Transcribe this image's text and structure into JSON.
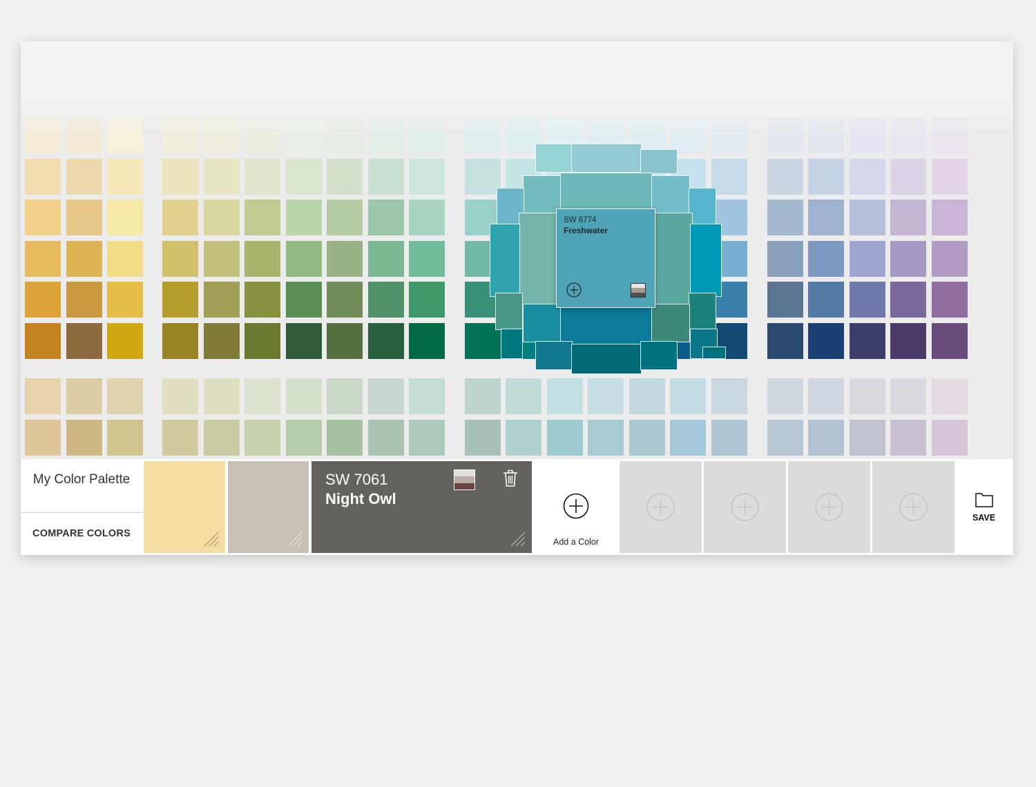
{
  "wall": {
    "columns": [
      [
        "#f5ecd8",
        "#f0dcae",
        "#f3d089",
        "#e8bb5e",
        "#dca33b",
        "#c38220",
        "#e6d3ac",
        "#ddc79b"
      ],
      [
        "#f3ead8",
        "#ecd9ad",
        "#e8c888",
        "#ddb353",
        "#c99a3f",
        "#8e6b3f",
        "#ddcda7",
        "#cdb785"
      ],
      [
        "#f7f0da",
        "#f7e8b8",
        "#f7e9a8",
        "#f2dc85",
        "#e3bd45",
        "#d0a812",
        "#dfd4ad",
        "#d1c48f"
      ],
      [
        "#f2eedd",
        "#ece4bc",
        "#e0d18f",
        "#d0c06a",
        "#b59d2e",
        "#988423",
        "#e2dec0",
        "#cfcb9f"
      ],
      [
        "#efeedf",
        "#e7e6c2",
        "#d8d7a0",
        "#c3c07d",
        "#a09f55",
        "#817b38",
        "#dedfc0",
        "#c9cca2"
      ],
      [
        "#eaeee0",
        "#dfe6cb",
        "#bfcb91",
        "#a7b56d",
        "#879140",
        "#6a7930",
        "#dae2cd",
        "#c6d1ad"
      ],
      [
        "#e9f0e6",
        "#d8e6cf",
        "#b8d6aa",
        "#93bb83",
        "#5b8e55",
        "#315c3b",
        "#d5e2ce",
        "#b4cca9"
      ],
      [
        "#e6ede4",
        "#d2e0cc",
        "#b4cba3",
        "#99b283",
        "#708c58",
        "#56713f",
        "#cbdac8",
        "#a6c1a2"
      ],
      [
        "#e3eee7",
        "#c9e1d2",
        "#9cc7aa",
        "#7db994",
        "#50916a",
        "#265e3e",
        "#c7d7cf",
        "#aac4b4"
      ],
      [
        "#e2eee9",
        "#cde6dc",
        "#a7d5c1",
        "#71bc98",
        "#3f9769",
        "#006b45",
        "#c4dcd1",
        "#acc9bb"
      ],
      [
        "#e1efef",
        "#c6e3df",
        "#98d1c8",
        "#73b9a8",
        "#399179",
        "#007356",
        "#bed4cc",
        "#a8c1b7"
      ],
      [
        "#e0efef",
        "#c5e4e4",
        "#8ed3d3",
        "#5fbdbd",
        "#2aa0a0",
        "#008181",
        "#c1dbd9",
        "#b2d0cf"
      ],
      [
        "#e2f0f3",
        "#c6e6ec",
        "#91d1db",
        "#5bb9c9",
        "#1a9fb4",
        "#007f94",
        "#c2dfe2",
        "#9fcbd0"
      ],
      [
        "#e1eff4",
        "#c7e5ef",
        "#93d3e7",
        "#57bcda",
        "#159fc4",
        "#007fa4",
        "#c5dde3",
        "#a8cbd3"
      ],
      [
        "#e1eef3",
        "#c9e4ee",
        "#a0d3e7",
        "#67bade",
        "#1a8ec2",
        "#05639a",
        "#c2d9e0",
        "#aac8d2"
      ],
      [
        "#e2eef3",
        "#c7e2ef",
        "#98cbe4",
        "#4fadd6",
        "#1a82b8",
        "#0a5a8a",
        "#c4dce4",
        "#a5c8d8"
      ],
      [
        "#e2ebf1",
        "#c7dceb",
        "#9fc4df",
        "#78aed0",
        "#3a80ab",
        "#124c74",
        "#c9d8e0",
        "#aec5d3"
      ],
      [
        "#e2e8ef",
        "#c9d5e1",
        "#a5b9cf",
        "#889fbb",
        "#5b7794",
        "#2a4a6f",
        "#cfd7de",
        "#b8c6d3"
      ],
      [
        "#e2e7ef",
        "#c6d2e5",
        "#9fb3d1",
        "#7d98c1",
        "#557aa6",
        "#1c3f72",
        "#d0d6df",
        "#b3c2d3"
      ],
      [
        "#e5e6f1",
        "#d5d8ec",
        "#b8bfdc",
        "#9ea6cf",
        "#7178aa",
        "#3d3e6b",
        "#d7d9df",
        "#bfc2cf"
      ],
      [
        "#e8e6f0",
        "#dbd3e6",
        "#c3b6d3",
        "#a598c4",
        "#7a6a9b",
        "#4a3b68",
        "#dcd8df",
        "#c9c0d1"
      ],
      [
        "#ebe6ef",
        "#e3d4e7",
        "#cbb5d6",
        "#b29bc5",
        "#8f6e9f",
        "#684b7b",
        "#e3dae2",
        "#d5c5d8"
      ]
    ]
  },
  "zoom": {
    "outer": [
      "#94d4d4",
      "#94cbd2",
      "#88c3ce",
      "#72bcbf",
      "#6db9b9",
      "#73bdca",
      "#6ab6c8",
      "#56b4cf",
      "#75b5a9",
      "#5aa6a0",
      "#2fa4af",
      "#0098b7",
      "#489686",
      "#1c827b",
      "#1a8ea1",
      "#0b7b9a",
      "#3c8978",
      "#00767e",
      "#0b7688",
      "#11778e",
      "#006b74",
      "#00747e",
      "#007180"
    ],
    "center_color": "#4ea4b6",
    "center_code": "SW 6774",
    "center_name": "Freshwater",
    "mini_stripes": [
      "#e6e6e6",
      "#a69c8c",
      "#4e4e4e"
    ]
  },
  "palette": {
    "title": "My Color Palette",
    "compare_label": "COMPARE COLORS",
    "swatches": [
      "#f5dca3",
      "#c8bfb5"
    ],
    "active": {
      "color": "#63625c",
      "code": "SW 7061",
      "name": "Night Owl",
      "mini_stripes": [
        "#e2dfd9",
        "#b8aea5",
        "#6b4343"
      ]
    },
    "add_label": "Add a Color",
    "empty_slots": 4,
    "save_label": "SAVE"
  }
}
